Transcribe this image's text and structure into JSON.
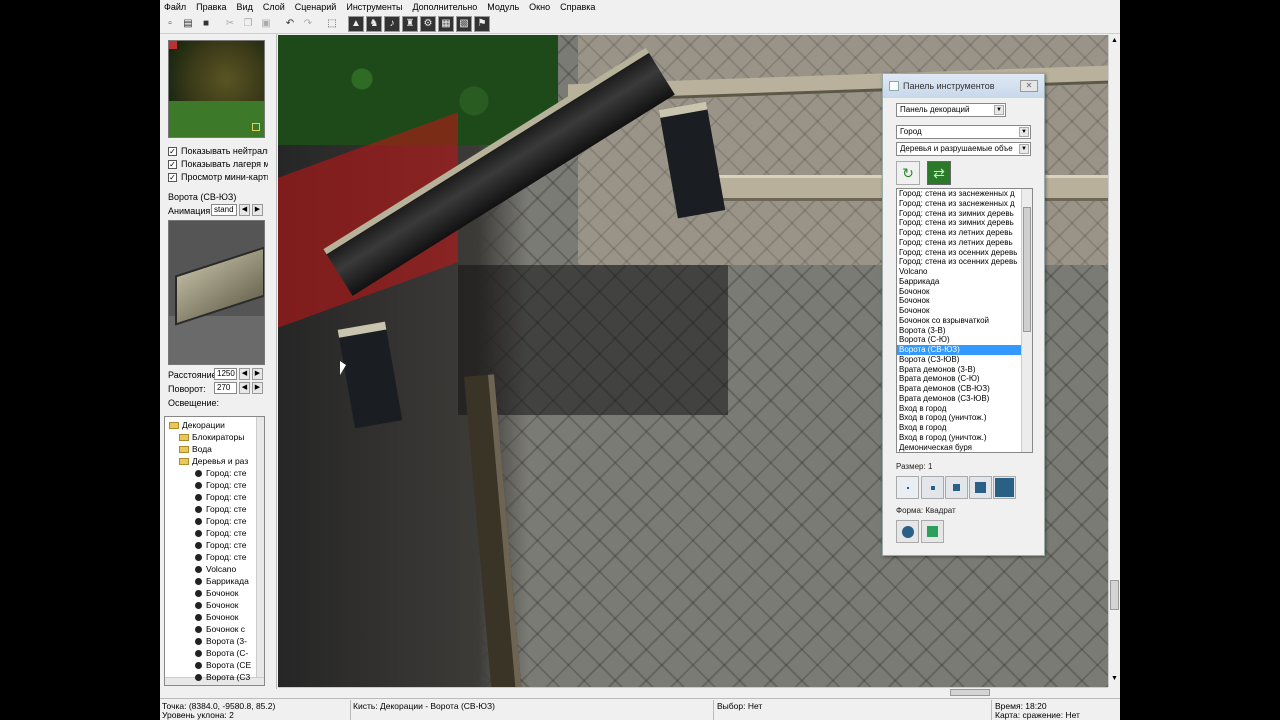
{
  "menu": [
    "Файл",
    "Правка",
    "Вид",
    "Слой",
    "Сценарий",
    "Инструменты",
    "Дополнительно",
    "Модуль",
    "Окно",
    "Справка"
  ],
  "left_panel": {
    "checkboxes": [
      "Показывать нейтраль",
      "Показывать лагеря м",
      "Просмотр мини-карты"
    ],
    "object_name": "Ворота (СВ-ЮЗ)",
    "animation_label": "Анимация:",
    "animation_value": "stand (",
    "distance_label": "Расстояние:",
    "distance_value": "1250",
    "rotation_label": "Поворот:",
    "rotation_value": "270",
    "lighting_label": "Освещение:",
    "tree": {
      "root": "Декорации",
      "folders": [
        "Блокираторы",
        "Вода",
        "Деревья и раз"
      ],
      "leaves": [
        "Город: сте",
        "Город: сте",
        "Город: сте",
        "Город: сте",
        "Город: сте",
        "Город: сте",
        "Город: сте",
        "Город: сте",
        "Volcano",
        "Баррикада",
        "Бочонок",
        "Бочонок",
        "Бочонок",
        "Бочонок с",
        "Ворота (3-",
        "Ворота (С-",
        "Ворота (СЕ",
        "Ворота (С3"
      ]
    }
  },
  "tool_panel": {
    "title": "Панель инструментов",
    "close_label": "✕",
    "panel_dropdown": "Панель декораций",
    "tileset_dropdown": "Город",
    "category_dropdown": "Деревья и разрушаемые объе",
    "list_items": [
      "Город: стена из заснеженных д",
      "Город: стена из заснеженных д",
      "Город: стена из зимних деревь",
      "Город: стена из зимних деревь",
      "Город: стена из летних деревь",
      "Город: стена из летних деревь",
      "Город: стена из осенних деревь",
      "Город: стена из осенних деревь",
      "Volcano",
      "Баррикада",
      "Бочонок",
      "Бочонок",
      "Бочонок",
      "Бочонок со взрывчаткой",
      "Ворота (3-В)",
      "Ворота (С-Ю)",
      "Ворота (СВ-ЮЗ)",
      "Ворота (С3-ЮВ)",
      "Врата демонов (3-В)",
      "Врата демонов (С-Ю)",
      "Врата демонов (СВ-ЮЗ)",
      "Врата демонов (С3-ЮВ)",
      "Вход в город",
      "Вход в город (уничтож.)",
      "Вход в город",
      "Вход в город (уничтож.)",
      "Демоническая буря"
    ],
    "selected_index": 16,
    "size_label": "Размер: 1",
    "shape_label": "Форма: Квадрат"
  },
  "status": {
    "point": "Точка: (8384.0, -9580.8, 85.2)",
    "slope": "Уровень уклона: 2",
    "brush": "Кисть: Декорации - Ворота (СВ-ЮЗ)",
    "selection": "Выбор: Нет",
    "time": "Время: 18:20",
    "map": "Карта: сражение: Нет"
  },
  "colors": {
    "selection": "#3399ff",
    "grass": "#1e4a1a",
    "red_highlight": "#c81414",
    "brush_green": "#2a7a2a"
  }
}
